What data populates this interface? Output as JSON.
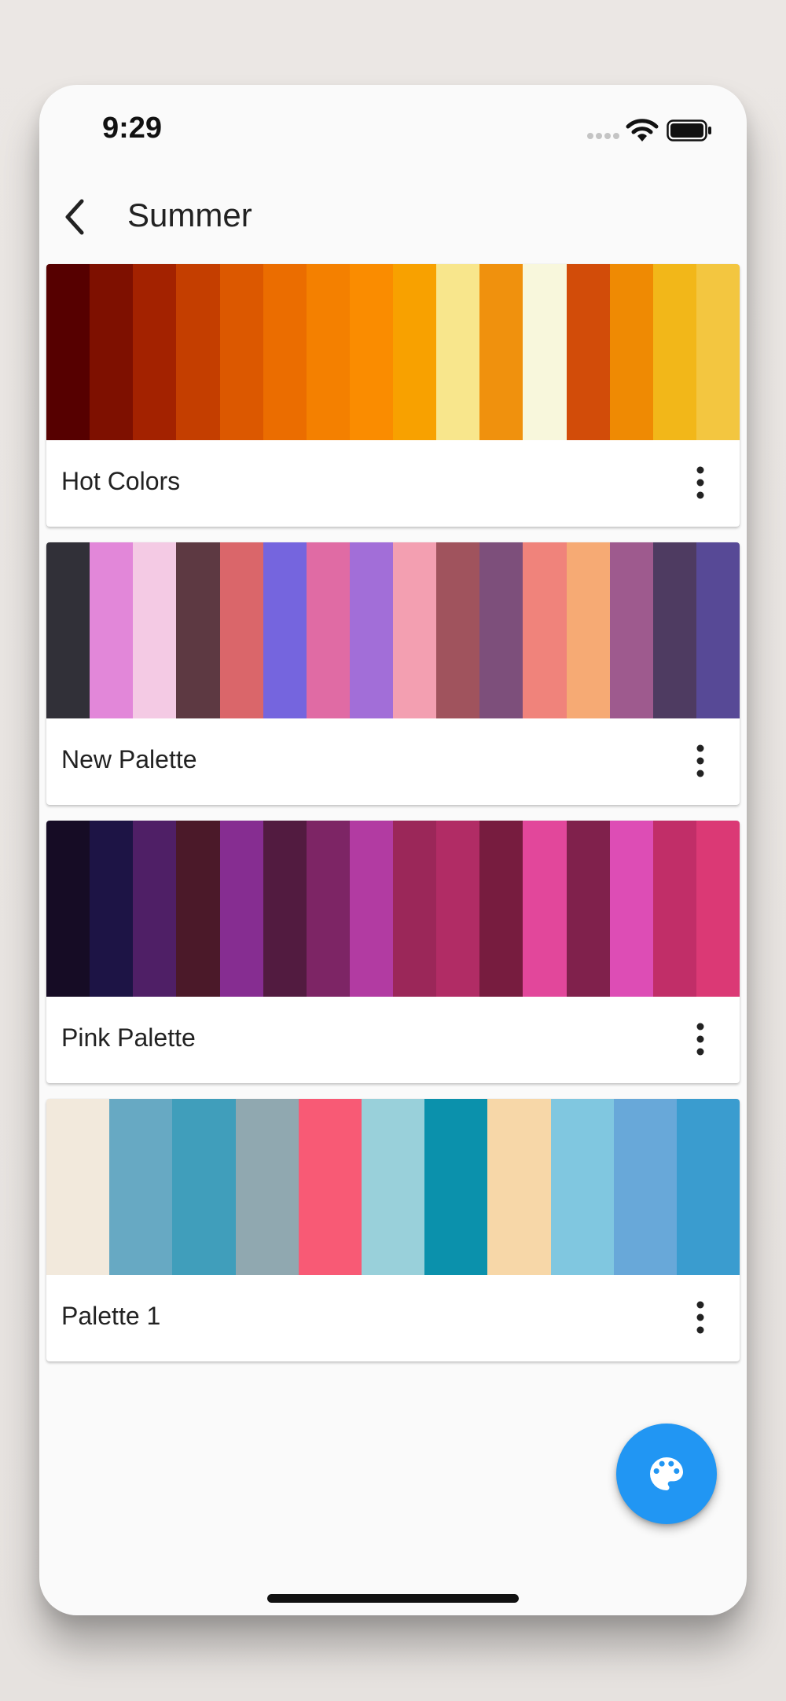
{
  "status_bar": {
    "time": "9:29",
    "icons": [
      "cellular-dots-icon",
      "wifi-icon",
      "battery-icon"
    ]
  },
  "app_bar": {
    "title": "Summer",
    "back_icon": "chevron-left-icon"
  },
  "palettes": [
    {
      "name": "Hot Colors",
      "colors": [
        "#560000",
        "#7e1000",
        "#a32200",
        "#c43e00",
        "#dc5800",
        "#eb6d00",
        "#f48000",
        "#fa8c00",
        "#f8a100",
        "#f8e68c",
        "#f0910d",
        "#f8f7dc",
        "#d24c09",
        "#ef8a03",
        "#f2b719",
        "#f3c640"
      ]
    },
    {
      "name": "New Palette",
      "colors": [
        "#313038",
        "#e287d9",
        "#f4cae4",
        "#5d3942",
        "#da666a",
        "#7565de",
        "#e06ba4",
        "#a26ed8",
        "#f39fb1",
        "#a0535d",
        "#7d4f7b",
        "#f0837b",
        "#f6aa74",
        "#9e5a8e",
        "#4e3b61",
        "#574996"
      ]
    },
    {
      "name": "Pink Palette",
      "colors": [
        "#160c25",
        "#1d1445",
        "#4f1f66",
        "#4b1929",
        "#862d91",
        "#521b40",
        "#7d2565",
        "#b23ba2",
        "#9b2759",
        "#b12c65",
        "#771c3f",
        "#e2479b",
        "#80214c",
        "#dd4db5",
        "#c12e68",
        "#db3975"
      ]
    },
    {
      "name": "Palette 1",
      "colors": [
        "#f2e9dc",
        "#67a9c3",
        "#409ebb",
        "#90a8b0",
        "#f85a75",
        "#99d0da",
        "#0b91ac",
        "#f7d7a8",
        "#80c7e0",
        "#68a8d9",
        "#3a9ccf"
      ]
    }
  ],
  "card_menu_icon": "more-vertical-icon",
  "fab": {
    "icon": "palette-icon",
    "color": "#2196f3"
  }
}
